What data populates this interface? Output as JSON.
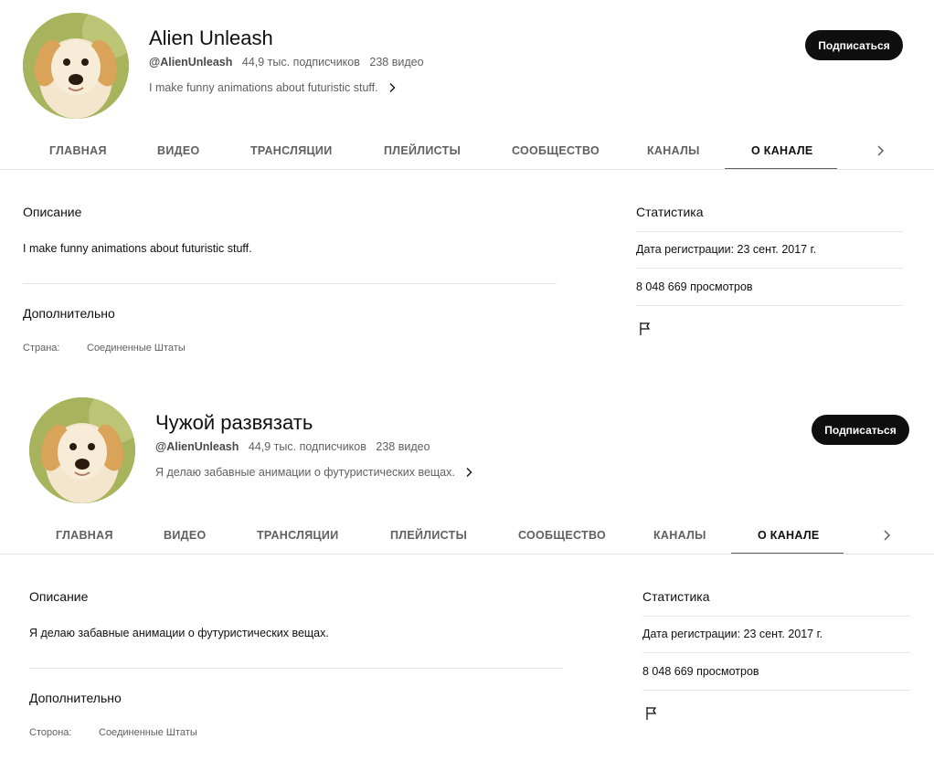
{
  "panels": [
    {
      "channel": {
        "title": "Alien Unleash",
        "handle": "@AlienUnleash",
        "subscribers": "44,9 тыс. подписчиков",
        "videos": "238 видео",
        "description_preview": "I make funny animations about futuristic stuff."
      },
      "subscribe_label": "Подписаться",
      "tabs": [
        "ГЛАВНАЯ",
        "ВИДЕО",
        "ТРАНСЛЯЦИИ",
        "ПЛЕЙЛИСТЫ",
        "СООБЩЕСТВО",
        "КАНАЛЫ",
        "О КАНАЛЕ"
      ],
      "active_tab": "О КАНАЛЕ",
      "about": {
        "description_heading": "Описание",
        "description_text": "I make funny animations about futuristic stuff.",
        "details_heading": "Дополнительно",
        "country_label": "Страна:",
        "country_value": "Соединенные Штаты"
      },
      "stats": {
        "heading": "Статистика",
        "joined": "Дата регистрации: 23 сент. 2017 г.",
        "views": "8 048 669 просмотров"
      }
    },
    {
      "channel": {
        "title": "Чужой развязать",
        "handle": "@AlienUnleash",
        "subscribers": "44,9 тыс. подписчиков",
        "videos": "238 видео",
        "description_preview": "Я делаю забавные анимации о футуристических вещах."
      },
      "subscribe_label": "Подписаться",
      "tabs": [
        "ГЛАВНАЯ",
        "ВИДЕО",
        "ТРАНСЛЯЦИИ",
        "ПЛЕЙЛИСТЫ",
        "СООБЩЕСТВО",
        "КАНАЛЫ",
        "О КАНАЛЕ"
      ],
      "active_tab": "О КАНАЛЕ",
      "about": {
        "description_heading": "Описание",
        "description_text": "Я делаю забавные анимации о футуристических вещах.",
        "details_heading": "Дополнительно",
        "country_label": "Сторона:",
        "country_value": "Соединенные Штаты"
      },
      "stats": {
        "heading": "Статистика",
        "joined": "Дата регистрации: 23 сент. 2017 г.",
        "views": "8 048 669 просмотров"
      }
    }
  ],
  "icons": {
    "avatar": "puppy-avatar",
    "chevron": "chevron-right-icon",
    "flag": "flag-icon"
  },
  "colors": {
    "button_bg": "#0f0f0f",
    "button_text": "#ffffff",
    "muted_text": "#606060",
    "divider": "#e5e5e5"
  }
}
